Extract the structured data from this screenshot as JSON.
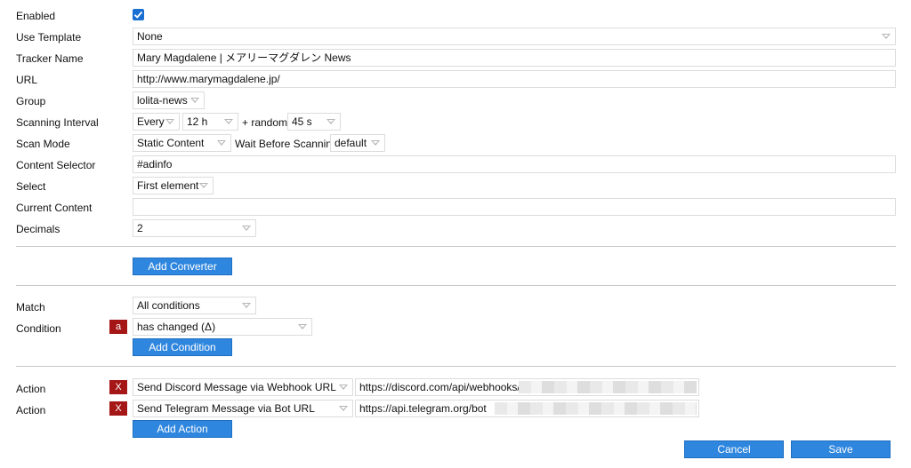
{
  "labels": {
    "enabled": "Enabled",
    "use_template": "Use Template",
    "tracker_name": "Tracker Name",
    "url": "URL",
    "group": "Group",
    "scanning_interval": "Scanning Interval",
    "scan_mode": "Scan Mode",
    "content_selector": "Content Selector",
    "select": "Select",
    "current_content": "Current Content",
    "decimals": "Decimals",
    "match": "Match",
    "condition": "Condition",
    "action1": "Action",
    "action2": "Action"
  },
  "values": {
    "enabled": true,
    "use_template": "None",
    "tracker_name": "Mary Magdalene | メアリーマグダレン News",
    "url": "http://www.marymagdalene.jp/",
    "group": "lolita-news",
    "interval_every": "Every",
    "interval_value": "12 h",
    "interval_plus_random": "+ random",
    "interval_random": "45 s",
    "scan_mode": "Static Content",
    "wait_before_scanning_label": "Wait Before Scanning",
    "wait_before_scanning": "default",
    "content_selector": "#adinfo",
    "select": "First element",
    "current_content": "",
    "decimals": "2",
    "match": "All conditions",
    "condition_badge": "a",
    "condition": "has changed (Δ)",
    "action1_badge": "X",
    "action1_type": "Send Discord Message via Webhook URL",
    "action1_url": "https://discord.com/api/webhooks/",
    "action2_badge": "X",
    "action2_type": "Send Telegram Message via Bot URL",
    "action2_url": "https://api.telegram.org/bot"
  },
  "buttons": {
    "add_converter": "Add Converter",
    "add_condition": "Add Condition",
    "add_action": "Add Action",
    "cancel": "Cancel",
    "save": "Save"
  },
  "colors": {
    "primary": "#2f86de",
    "danger": "#a51616",
    "checkbox": "#1b6fd2"
  }
}
